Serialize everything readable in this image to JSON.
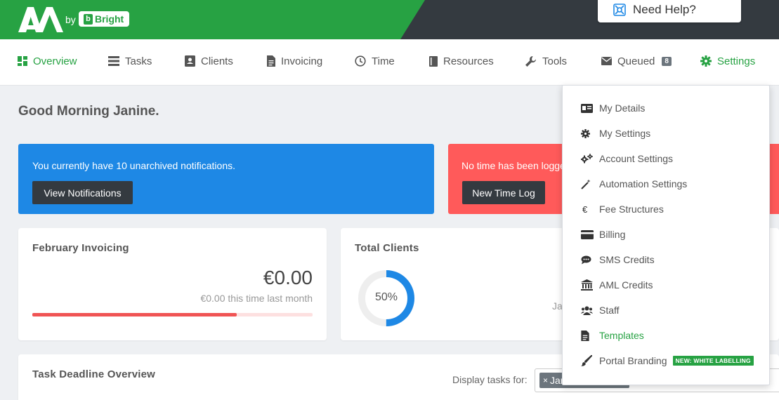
{
  "header": {
    "by_text": "by",
    "bright_label": "Bright",
    "help_label": "Need Help?"
  },
  "nav": {
    "items": [
      {
        "label": "Overview",
        "icon": "dashboard-icon"
      },
      {
        "label": "Tasks",
        "icon": "list-icon"
      },
      {
        "label": "Clients",
        "icon": "contact-card-icon"
      },
      {
        "label": "Invoicing",
        "icon": "document-icon"
      },
      {
        "label": "Time",
        "icon": "clock-icon"
      },
      {
        "label": "Resources",
        "icon": "book-icon"
      },
      {
        "label": "Tools",
        "icon": "wrench-icon"
      },
      {
        "label": "Queued",
        "icon": "envelope-icon",
        "badge": "8"
      },
      {
        "label": "Settings",
        "icon": "gear-icon"
      }
    ],
    "active": "Overview"
  },
  "greeting": "Good Morning Janine.",
  "notifications_alert": {
    "text": "You currently have 10 unarchived notifications.",
    "button": "View Notifications",
    "color": "#1e88e5"
  },
  "time_alert": {
    "text": "No time has been logge",
    "button": "New Time Log",
    "color": "#ff5a5a"
  },
  "invoicing_card": {
    "title": "February Invoicing",
    "amount": "€0.00",
    "subtext": "€0.00 this time last month",
    "progress": 0.73
  },
  "clients_card": {
    "title": "Total Clients",
    "percent_label": "50%",
    "percent": 0.5,
    "partial_text": "Ja"
  },
  "deadline_card": {
    "title": "Task Deadline Overview",
    "display_label": "Display tasks for:",
    "selected_tag": "Jan"
  },
  "settings_menu": {
    "items": [
      {
        "label": "My Details",
        "icon": "id-card-icon"
      },
      {
        "label": "My Settings",
        "icon": "gear-icon"
      },
      {
        "label": "Account Settings",
        "icon": "gears-icon"
      },
      {
        "label": "Automation Settings",
        "icon": "magic-wand-icon"
      },
      {
        "label": "Fee Structures",
        "icon": "euro-icon",
        "glyph": "€"
      },
      {
        "label": "Billing",
        "icon": "credit-card-icon"
      },
      {
        "label": "SMS Credits",
        "icon": "comment-icon"
      },
      {
        "label": "AML Credits",
        "icon": "bank-icon"
      },
      {
        "label": "Staff",
        "icon": "users-icon"
      },
      {
        "label": "Templates",
        "icon": "file-icon",
        "active": true
      },
      {
        "label": "Portal Branding",
        "icon": "paintbrush-icon",
        "badge": "NEW: WHITE LABELLING"
      }
    ]
  },
  "colors": {
    "brand_green": "#27a243",
    "header_dark": "#343a40",
    "alert_blue": "#1e88e5",
    "alert_red": "#ff5a5a",
    "progress_red": "#f05454"
  }
}
